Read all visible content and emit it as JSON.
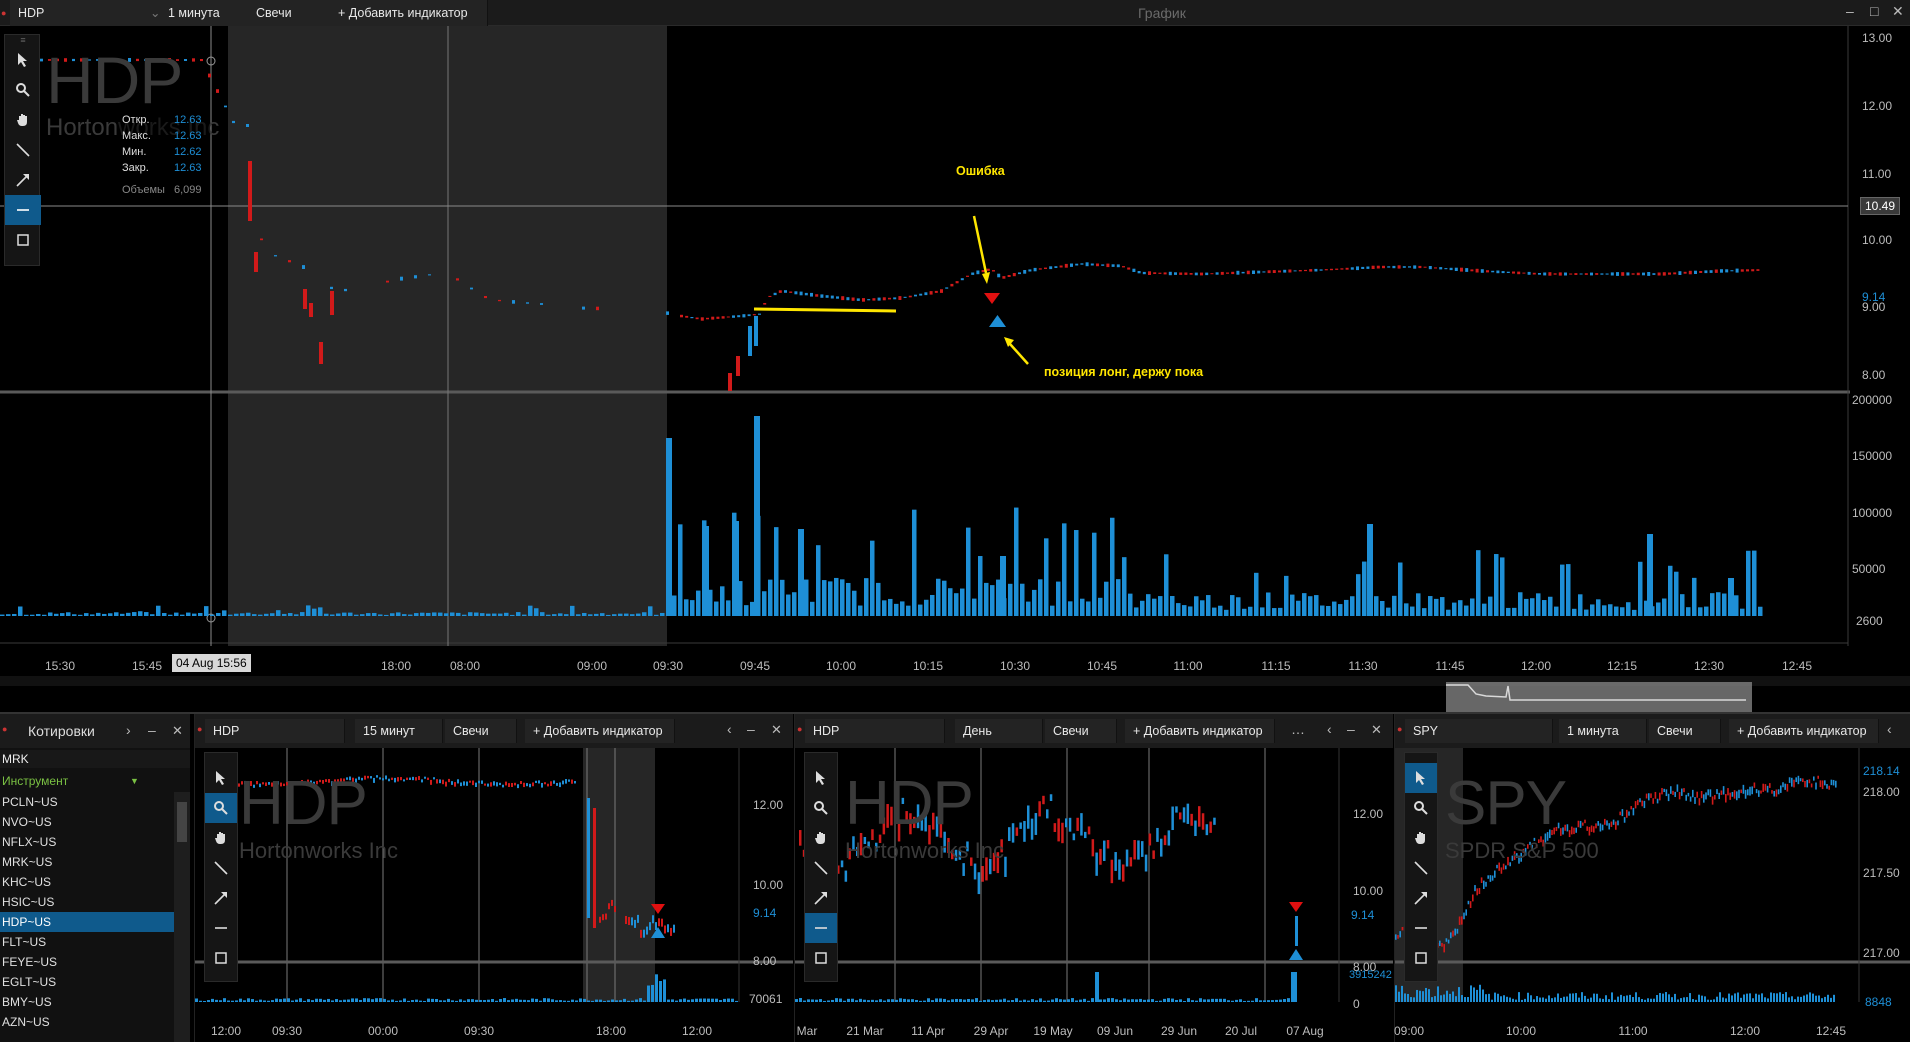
{
  "main": {
    "toolbar": {
      "symbol": "HDP",
      "timeframe": "1 минута",
      "chart_type": "Свечи",
      "add_indicator": "+ Добавить индикатор",
      "window_title": "График"
    },
    "legend": {
      "symbol": "HDP",
      "company": "Hortonworks Inc",
      "open_label": "Откр.",
      "open": "12.63",
      "high_label": "Макс.",
      "high": "12.63",
      "low_label": "Мин.",
      "low": "12.62",
      "close_label": "Закр.",
      "close": "12.63",
      "volume_label": "Объемы",
      "volume": "6,099"
    },
    "price_axis": [
      "13.00",
      "12.00",
      "11.00",
      "10.00",
      "9.00",
      "8.00"
    ],
    "crosshair_price": "10.49",
    "last_price": "9.14",
    "volume_axis": [
      "200000",
      "150000",
      "100000",
      "50000",
      "2600"
    ],
    "time_axis": [
      "15:30",
      "15:45",
      "18:00",
      "08:00",
      "09:00",
      "09:30",
      "09:45",
      "10:00",
      "10:15",
      "10:30",
      "10:45",
      "11:00",
      "11:15",
      "11:30",
      "11:45",
      "12:00",
      "12:15",
      "12:30",
      "12:45"
    ],
    "crosshair_time": "04 Aug 15:56",
    "annotations": {
      "error": "Ошибка",
      "position": "позиция лонг, держу пока"
    }
  },
  "watchlist": {
    "title": "Котировки",
    "input": "MRK",
    "column": "Инструмент",
    "items": [
      "PCLN~US",
      "NVO~US",
      "NFLX~US",
      "MRK~US",
      "KHC~US",
      "HSIC~US",
      "HDP~US",
      "FLT~US",
      "FEYE~US",
      "EGLT~US",
      "BMY~US",
      "AZN~US"
    ],
    "selected": "HDP~US"
  },
  "panel1": {
    "symbol": "HDP",
    "timeframe": "15 минут",
    "chart_type": "Свечи",
    "add_indicator": "+ Добавить индикатор",
    "company": "Hortonworks Inc",
    "price_axis": [
      "12.00",
      "10.00",
      "9.14",
      "8.00"
    ],
    "volume_label": "70061",
    "time_axis": [
      "12:00",
      "09:30",
      "00:00",
      "09:30",
      "18:00",
      "12:00"
    ]
  },
  "panel2": {
    "symbol": "HDP",
    "timeframe": "День",
    "chart_type": "Свечи",
    "add_indicator": "+ Добавить индикатор",
    "company": "Hortonworks Inc",
    "price_axis": [
      "12.00",
      "10.00",
      "9.14",
      "8.00"
    ],
    "volume_label": "3915242",
    "volume_zero": "0",
    "time_axis": [
      "Mar",
      "21 Mar",
      "11 Apr",
      "29 Apr",
      "19 May",
      "09 Jun",
      "29 Jun",
      "20 Jul",
      "07 Aug"
    ]
  },
  "panel3": {
    "symbol": "SPY",
    "timeframe": "1 минута",
    "chart_type": "Свечи",
    "add_indicator": "+ Добавить индикатор",
    "company": "SPDR S&P 500",
    "price_axis": [
      "218.14",
      "218.00",
      "217.50",
      "217.00"
    ],
    "volume_label": "8848",
    "time_axis": [
      "09:00",
      "10:00",
      "11:00",
      "12:00",
      "12:45"
    ]
  },
  "colors": {
    "up": "#1e8fd6",
    "down": "#d11a1a",
    "accent": "#0f5a8c",
    "annotation": "#ffe600",
    "crosshair": "#8a8a8a"
  }
}
